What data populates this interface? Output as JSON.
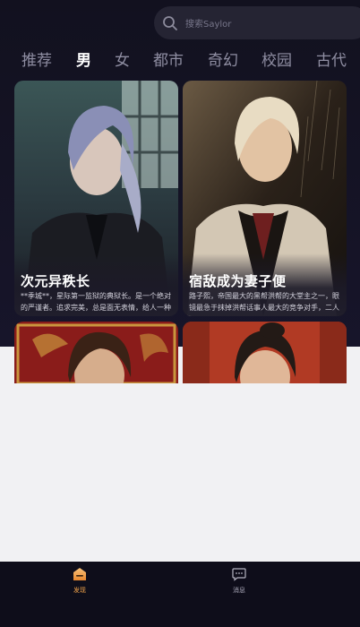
{
  "search": {
    "placeholder": "搜索Saylor"
  },
  "tabs": [
    "推荐",
    "男",
    "女",
    "都市",
    "奇幻",
    "校园",
    "古代"
  ],
  "active_tab": "男",
  "cards": [
    {
      "title": "次元异秩长",
      "desc": "**季城**，星际第一监狱的典狱长。是一个绝对的严谨者。追求完美，总是面无表情，给人一种不容置疑的压迫感……"
    },
    {
      "title": "宿敌成为妻子便",
      "desc": "路子熙，帝国最大的黑帮洪帮的大堂主之一，眼镜最急于抹掉洪帮话事人最大的竞争对手，二人自..."
    },
    {
      "title": "",
      "desc": ""
    },
    {
      "title": "",
      "desc": ""
    }
  ],
  "nav": {
    "discover_label": "发现",
    "messages_label": "消息"
  },
  "colors": {
    "accent": "#f0a24a",
    "background_dark": "#12111f",
    "page_bg": "#f1f1f3"
  }
}
